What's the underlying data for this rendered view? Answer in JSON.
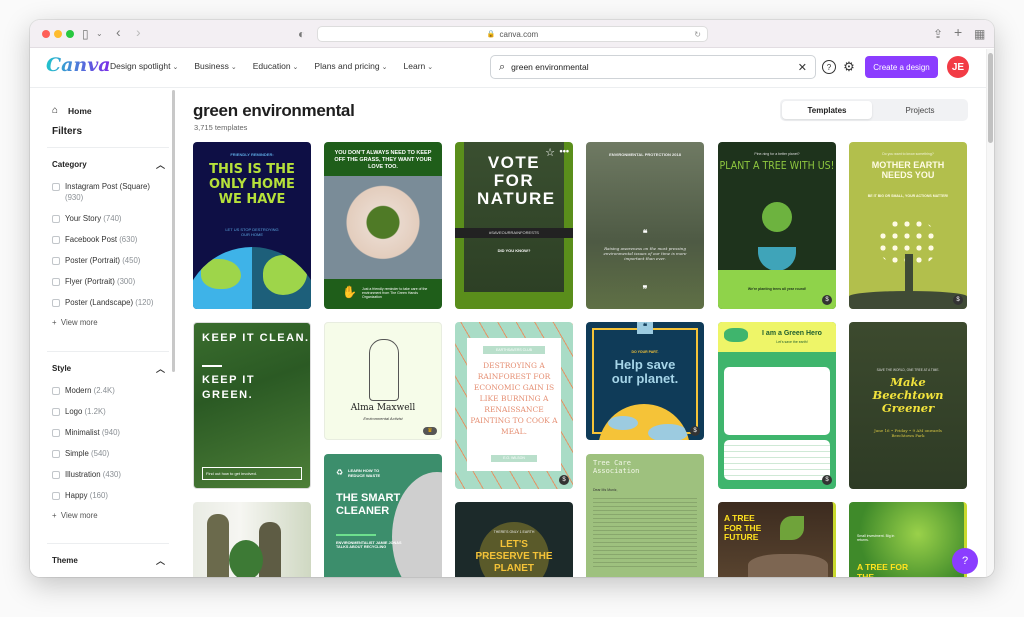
{
  "browser": {
    "url": "canva.com",
    "lock_icon": "🔒",
    "reload_icon": "↻"
  },
  "header": {
    "logo": "Canva",
    "nav": [
      {
        "label": "Design spotlight"
      },
      {
        "label": "Business"
      },
      {
        "label": "Education"
      },
      {
        "label": "Plans and pricing"
      },
      {
        "label": "Learn"
      }
    ],
    "chevron": "⌄",
    "search_value": "green environmental",
    "search_icon": "⌕",
    "clear_icon": "✕",
    "help_icon": "?",
    "settings_icon": "⚙",
    "create_label": "Create a design",
    "avatar_initials": "JE",
    "accent": "#8b3dff"
  },
  "sidebar": {
    "home_label": "Home",
    "filters_title": "Filters",
    "sections": [
      {
        "title": "Category",
        "options": [
          {
            "label": "Instagram Post (Square)",
            "count": "(930)"
          },
          {
            "label": "Your Story",
            "count": "(740)"
          },
          {
            "label": "Facebook Post",
            "count": "(630)"
          },
          {
            "label": "Poster (Portrait)",
            "count": "(450)"
          },
          {
            "label": "Flyer (Portrait)",
            "count": "(300)"
          },
          {
            "label": "Poster (Landscape)",
            "count": "(120)"
          }
        ],
        "more": "View more"
      },
      {
        "title": "Style",
        "options": [
          {
            "label": "Modern",
            "count": "(2.4K)"
          },
          {
            "label": "Logo",
            "count": "(1.2K)"
          },
          {
            "label": "Minimalist",
            "count": "(940)"
          },
          {
            "label": "Simple",
            "count": "(540)"
          },
          {
            "label": "Illustration",
            "count": "(430)"
          },
          {
            "label": "Happy",
            "count": "(160)"
          }
        ],
        "more": "View more"
      },
      {
        "title": "Theme"
      }
    ]
  },
  "main": {
    "title": "green environmental",
    "count": "3,715 templates",
    "tabs": [
      {
        "label": "Templates"
      },
      {
        "label": "Projects"
      }
    ],
    "templates": [
      {
        "name": "this-is-the-only-home",
        "top": "FRIENDLY REMINDER:",
        "headline": "THIS IS THE ONLY HOME WE HAVE",
        "sub": "LET US STOP DESTROYING OUR HOME"
      },
      {
        "name": "keep-off-the-grass",
        "headline": "YOU DON'T ALWAYS NEED TO KEEP OFF THE GRASS, THEY WANT YOUR LOVE TOO.",
        "sub": "Just a friendly reminder to take care of the environment from The Green Hands Organization"
      },
      {
        "name": "vote-for-nature",
        "headline": "VOTE FOR NATURE",
        "band": "#SAVEOURRAINFORESTS",
        "sub": "DID YOU KNOW?"
      },
      {
        "name": "environmental-protection",
        "top": "ENVIRONMENTAL PROTECTION 2018",
        "quote": "Raising awareness on the most pressing environmental issues of our time is more important than ever."
      },
      {
        "name": "plant-a-tree",
        "top": "Pine-ning for a better planet?",
        "headline": "PLANT A TREE WITH US!",
        "sub": "We're planting trees all year round!"
      },
      {
        "name": "mother-earth",
        "top": "Do you want to know something?",
        "headline": "MOTHER EARTH NEEDS YOU",
        "sub": "BE IT BIG OR SMALL, YOUR ACTIONS MATTER!"
      },
      {
        "name": "keep-it-clean",
        "headline1": "KEEP IT CLEAN.",
        "headline2": "KEEP IT GREEN.",
        "sub": "Find out how to get involved."
      },
      {
        "name": "alma-maxwell",
        "headline": "Alma Maxwell",
        "sub": "Environmental Activist"
      },
      {
        "name": "destroying-a-rainforest",
        "top": "EARTHSAVERS CLUB",
        "headline": "DESTROYING A RAINFOREST FOR ECONOMIC GAIN IS LIKE BURNING A RENAISSANCE PAINTING TO COOK A MEAL.",
        "sub": "E.O. WILSON"
      },
      {
        "name": "help-save-our-planet",
        "top": "DO YOUR PART.",
        "headline": "Help save our planet."
      },
      {
        "name": "green-hero",
        "headline": "I am a Green Hero",
        "sub": "Let's save the earth!"
      },
      {
        "name": "make-beechtown-greener",
        "top": "SAVE THE WORLD, ONE TREE AT A TIME.",
        "headline": "Make Beechtown Greener",
        "sub": "June 16 • Friday • 9 AM onwards Beechtown Park"
      },
      {
        "name": "the-smart-cleaner",
        "top": "LEARN HOW TO REDUCE WASTE",
        "headline": "THE SMART CLEANER",
        "sub": "ENVIRONMENTALIST JAMIE JONAS TALKS ABOUT RECYCLING"
      },
      {
        "name": "tree-care-association",
        "headline": "Tree Care Association",
        "sub": "Dear Ms Muniz,"
      },
      {
        "name": "lets-preserve-the-planet",
        "top": "THERE'S ONLY 1 EARTH",
        "headline": "LET'S PRESERVE THE PLANET"
      },
      {
        "name": "a-tree-for-the-future",
        "headline": "A TREE FOR THE FUTURE"
      },
      {
        "name": "a-tree-for-the-future-2",
        "top": "Small investment. Big in returns.",
        "headline": "A TREE FOR THE"
      },
      {
        "name": "plant-photo"
      }
    ],
    "premium_badge": "$",
    "help_button": "?"
  }
}
